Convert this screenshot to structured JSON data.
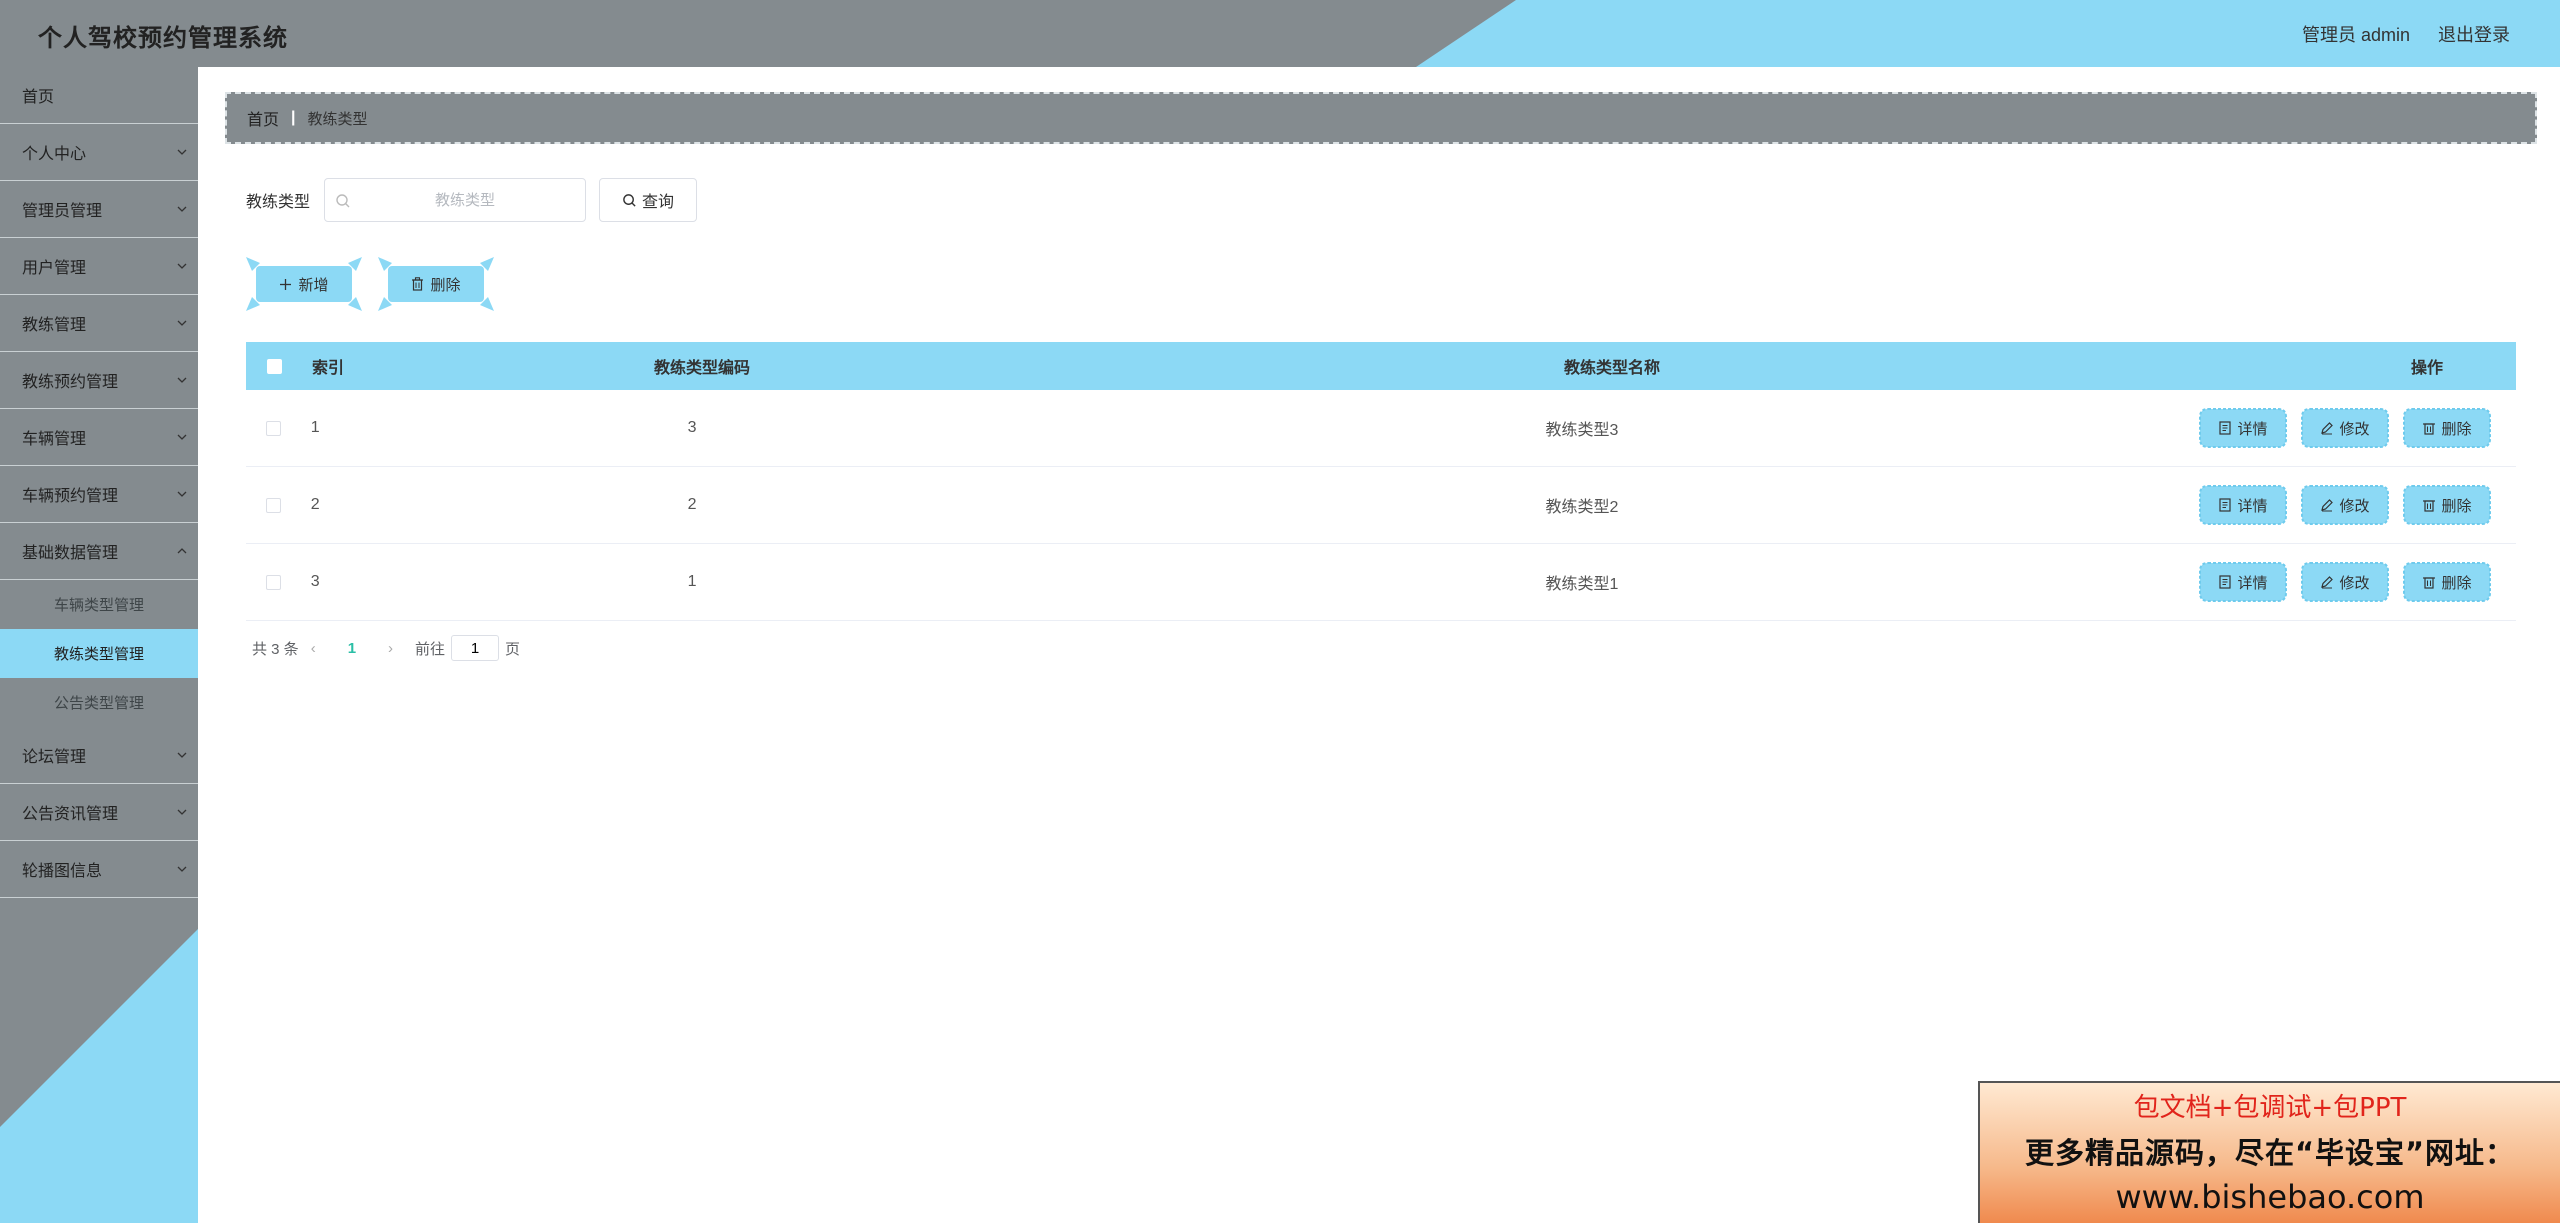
{
  "header": {
    "title": "个人驾校预约管理系统",
    "user": "管理员 admin",
    "logout": "退出登录"
  },
  "sidebar": {
    "items": [
      {
        "label": "首页",
        "has_children": false
      },
      {
        "label": "个人中心",
        "has_children": true
      },
      {
        "label": "管理员管理",
        "has_children": true
      },
      {
        "label": "用户管理",
        "has_children": true
      },
      {
        "label": "教练管理",
        "has_children": true
      },
      {
        "label": "教练预约管理",
        "has_children": true
      },
      {
        "label": "车辆管理",
        "has_children": true
      },
      {
        "label": "车辆预约管理",
        "has_children": true
      },
      {
        "label": "基础数据管理",
        "has_children": true
      }
    ],
    "submenu": [
      {
        "label": "车辆类型管理",
        "active": false
      },
      {
        "label": "教练类型管理",
        "active": true
      },
      {
        "label": "公告类型管理",
        "active": false
      }
    ],
    "items_after": [
      {
        "label": "论坛管理"
      },
      {
        "label": "公告资讯管理"
      },
      {
        "label": "轮播图信息"
      }
    ]
  },
  "breadcrumb": {
    "home": "首页",
    "separator": "|",
    "current": "教练类型"
  },
  "search": {
    "label": "教练类型",
    "placeholder": "教练类型",
    "query_label": "查询"
  },
  "actions": {
    "add_label": "新增",
    "delete_label": "删除"
  },
  "table": {
    "columns": [
      "索引",
      "教练类型编码",
      "教练类型名称",
      "操作"
    ],
    "rows": [
      {
        "index": "1",
        "code": "3",
        "name": "教练类型3"
      },
      {
        "index": "2",
        "code": "2",
        "name": "教练类型2"
      },
      {
        "index": "3",
        "code": "1",
        "name": "教练类型1"
      }
    ],
    "op_labels": {
      "detail": "详情",
      "edit": "修改",
      "delete": "删除"
    }
  },
  "pagination": {
    "total": "共 3 条",
    "current_page": "1",
    "goto_prefix": "前往",
    "goto_value": "1",
    "goto_suffix": "页"
  },
  "ad": {
    "line1": "包文档+包调试+包PPT",
    "line2": "更多精品源码，尽在“毕设宝”网址：",
    "line3": "www.bishebao.com"
  },
  "colors": {
    "accent": "#8cd9f5",
    "gray": "#848b8f",
    "page_active": "#2bbfa6"
  }
}
